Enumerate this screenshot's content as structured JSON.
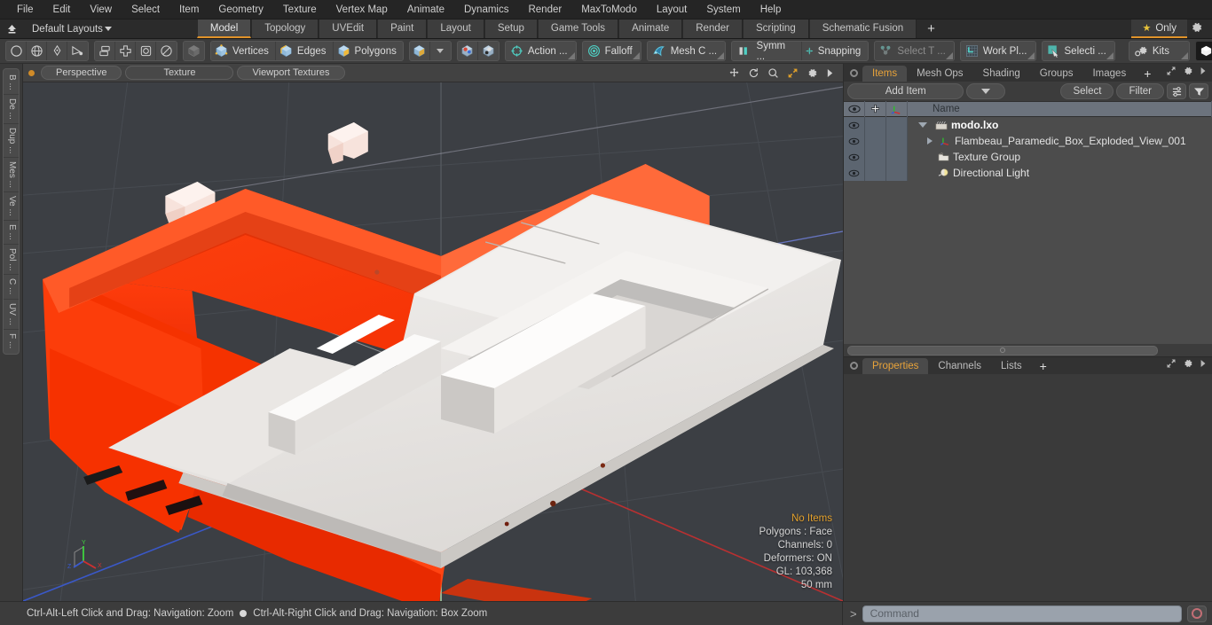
{
  "menubar": {
    "items": [
      "File",
      "Edit",
      "View",
      "Select",
      "Item",
      "Geometry",
      "Texture",
      "Vertex Map",
      "Animate",
      "Dynamics",
      "Render",
      "MaxToModo",
      "Layout",
      "System",
      "Help"
    ]
  },
  "layoutbar": {
    "home_icon": "home-up-icon",
    "layout_label": "Default Layouts",
    "tabs": [
      {
        "label": "Model",
        "active": true
      },
      {
        "label": "Topology",
        "active": false
      },
      {
        "label": "UVEdit",
        "active": false
      },
      {
        "label": "Paint",
        "active": false
      },
      {
        "label": "Layout",
        "active": false
      },
      {
        "label": "Setup",
        "active": false
      },
      {
        "label": "Game Tools",
        "active": false
      },
      {
        "label": "Animate",
        "active": false
      },
      {
        "label": "Render",
        "active": false
      },
      {
        "label": "Scripting",
        "active": false
      },
      {
        "label": "Schematic Fusion",
        "active": false
      }
    ],
    "add_tab_label": "+",
    "only_label": "Only",
    "only_star_color": "#e8c33a",
    "gear_icon": "gear-icon"
  },
  "toolbar": {
    "shape_tools": [
      "circle-icon",
      "globe-icon",
      "pen-icon",
      "curve-icon"
    ],
    "mode_tools": [
      "mirror-icon",
      "center-icon",
      "rounded-square-icon",
      "ellipse-icon"
    ],
    "solo_cube": "dark-cube-icon",
    "selection_modes": [
      {
        "label": "Vertices",
        "icon": "vertices-cube-icon"
      },
      {
        "label": "Edges",
        "icon": "edges-cube-icon"
      },
      {
        "label": "Polygons",
        "icon": "polygons-cube-icon"
      }
    ],
    "items_mode": {
      "label": "",
      "icon": "items-cube-icon"
    },
    "pivot_tools": [
      "pivot-cube-icon",
      "pivot-alt-cube-icon"
    ],
    "action_label": "Action   ...",
    "falloff_label": "Falloff",
    "meshconstraint_label": "Mesh C ...",
    "symmetry_label": "Symm ...",
    "snapping_label": "Snapping",
    "select_through_label": "Select T ...",
    "workplane_label": "Work Pl...",
    "selection_set_label": "Selecti  ...",
    "kits_label": "Kits",
    "modo_icon": "modo-logo-icon",
    "unreal_icon": "unreal-logo-icon"
  },
  "left_strip": {
    "tabs": [
      "B ...",
      "De ...",
      "Dup ...",
      "Mes ...",
      "Ve ...",
      "E ...",
      "Pol ...",
      "C ...",
      "UV ...",
      "F ..."
    ]
  },
  "viewport": {
    "header": {
      "indicator": "orange-dot",
      "mode_buttons": [
        "Perspective",
        "Texture",
        "Viewport Textures"
      ],
      "right_icons": [
        "move-icon",
        "rotate-icon",
        "zoom-icon",
        "expand-icon",
        "gear-icon",
        "chevron-right-icon"
      ]
    },
    "info": {
      "items_status": "No Items",
      "polygons": "Polygons : Face",
      "channels": "Channels: 0",
      "deformers": "Deformers: ON",
      "gl": "GL: 103,368",
      "scale": "50 mm"
    },
    "axis_labels": {
      "x": "X",
      "y": "Y",
      "z": "Z"
    },
    "model": {
      "name": "Flambeau Paramedic Box Exploded View",
      "body_color": "#fc3a08",
      "tray_color": "#e8e6e4",
      "background_color": "#3c3f44"
    }
  },
  "right_panel": {
    "tabs": [
      {
        "label": "Items",
        "active": true
      },
      {
        "label": "Mesh Ops",
        "active": false
      },
      {
        "label": "Shading",
        "active": false
      },
      {
        "label": "Groups",
        "active": false
      },
      {
        "label": "Images",
        "active": false
      }
    ],
    "add_tab_label": "+",
    "toolbar": {
      "add_item_label": "Add Item",
      "select_label": "Select",
      "filter_label": "Filter"
    },
    "tree_header": {
      "col_visible": "eye-icon",
      "col_lock": "plus-icon",
      "col_axis": "axis-icon",
      "col_name": "Name"
    },
    "tree_rows": [
      {
        "label": "modo.lxo",
        "icon": "scene-clapper-icon",
        "indent": 0,
        "expanded": true,
        "bold": true
      },
      {
        "label": "Flambeau_Paramedic_Box_Exploded_View_001",
        "icon": "mesh-axis-icon",
        "indent": 1,
        "expanded": false,
        "bold": false
      },
      {
        "label": "Texture Group",
        "icon": "texture-group-icon",
        "indent": 1,
        "expanded": null,
        "bold": false
      },
      {
        "label": "Directional Light",
        "icon": "light-icon",
        "indent": 1,
        "expanded": null,
        "bold": false
      }
    ],
    "properties_tabs": [
      {
        "label": "Properties",
        "active": true
      },
      {
        "label": "Channels",
        "active": false
      },
      {
        "label": "Lists",
        "active": false
      }
    ],
    "properties_add_label": "+"
  },
  "statusbar": {
    "hint_left": "Ctrl-Alt-Left Click and Drag: Navigation: Zoom",
    "hint_right": "Ctrl-Alt-Right Click and Drag: Navigation: Box Zoom",
    "command_prompt": ">",
    "command_placeholder": "Command",
    "command_value": "",
    "record_icon": "record-circle-icon"
  }
}
